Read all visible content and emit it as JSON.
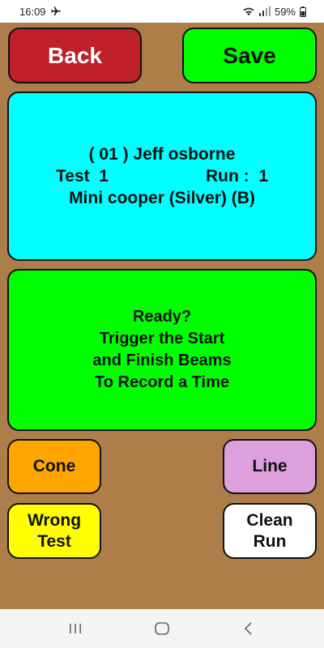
{
  "status_bar": {
    "time": "16:09",
    "battery": "59%"
  },
  "header": {
    "back_label": "Back",
    "save_label": "Save"
  },
  "info_panel": {
    "driver_line": "( 01 ) Jeff osborne",
    "test_label": "Test  1",
    "run_label": "Run :  1",
    "car_line": "Mini cooper (Silver) (B)"
  },
  "ready_panel": {
    "line1": "Ready?",
    "line2": "Trigger the Start",
    "line3": "and Finish Beams",
    "line4": "To Record a Time"
  },
  "penalty_buttons": {
    "cone": "Cone",
    "line": "Line",
    "wrong_test_1": "Wrong",
    "wrong_test_2": "Test",
    "clean_run_1": "Clean",
    "clean_run_2": "Run"
  },
  "colors": {
    "background": "#ad7d4a",
    "back_button": "#c0202a",
    "save_button": "#00ff00",
    "info_panel": "#00ffff",
    "ready_panel": "#00ff00",
    "cone_button": "#ffa500",
    "line_button": "#dda0dd",
    "wrong_test_button": "#ffff00",
    "clean_run_button": "#ffffff"
  },
  "icons": {
    "airplane": "airplane-mode-icon",
    "wifi": "wifi-icon",
    "signal": "signal-icon",
    "battery": "battery-icon",
    "recents": "recent-apps-icon",
    "home": "home-icon",
    "back": "back-nav-icon"
  }
}
